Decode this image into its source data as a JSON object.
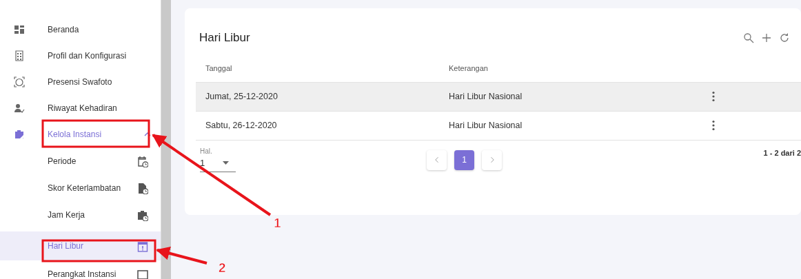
{
  "sidebar": {
    "items": [
      {
        "label": "Beranda",
        "selected": false
      },
      {
        "label": "Profil dan Konfigurasi",
        "selected": false
      },
      {
        "label": "Presensi Swafoto",
        "selected": false
      },
      {
        "label": "Riwayat Kehadiran",
        "selected": false
      },
      {
        "label": "Kelola Instansi",
        "selected": true,
        "expanded": true,
        "children": [
          {
            "label": "Periode",
            "selected": false
          },
          {
            "label": "Skor Keterlambatan",
            "selected": false
          },
          {
            "label": "Jam Kerja",
            "selected": false
          },
          {
            "label": "Hari Libur",
            "selected": true
          },
          {
            "label": "Perangkat Instansi",
            "selected": false
          }
        ]
      }
    ]
  },
  "card": {
    "title": "Hari Libur",
    "table": {
      "columns": [
        "Tanggal",
        "Keterangan"
      ],
      "rows": [
        {
          "cells": [
            "Jumat, 25-12-2020",
            "Hari Libur Nasional"
          ],
          "hovered": true
        },
        {
          "cells": [
            "Sabtu, 26-12-2020",
            "Hari Libur Nasional"
          ],
          "hovered": false
        }
      ]
    },
    "page_field": {
      "label": "Hal.",
      "value": "1"
    },
    "pages": [
      {
        "label": "1",
        "selected": true
      }
    ],
    "range": "1 - 2 dari 2"
  },
  "annotations": [
    {
      "label": "1"
    },
    {
      "label": "2"
    }
  ]
}
